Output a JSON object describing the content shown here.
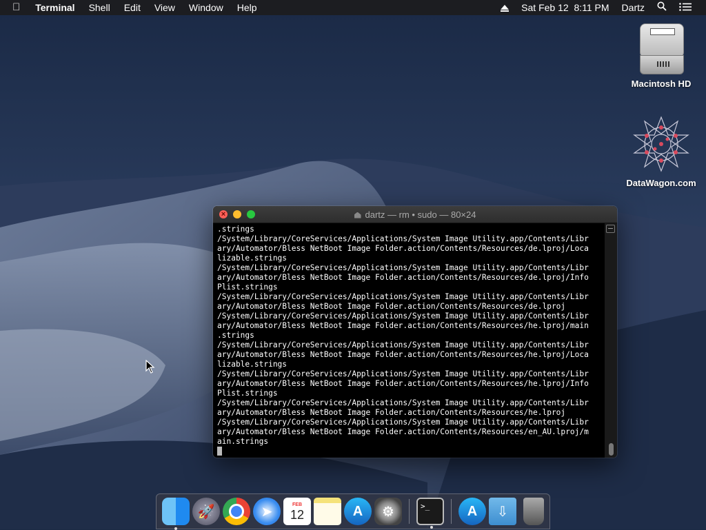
{
  "menubar": {
    "apple_icon": "apple-logo",
    "app_name": "Terminal",
    "menus": [
      "Shell",
      "Edit",
      "View",
      "Window",
      "Help"
    ],
    "clock": "Sat Feb 12  8:11 PM",
    "user": "Dartz"
  },
  "desktop": {
    "icons": [
      {
        "label": "Macintosh HD",
        "icon": "hard-drive"
      },
      {
        "label": "DataWagon.com",
        "icon": "geometric-star"
      }
    ]
  },
  "terminal": {
    "title": "dartz — rm • sudo — 80×24",
    "lines": [
      ".strings",
      "/System/Library/CoreServices/Applications/System Image Utility.app/Contents/Libr",
      "ary/Automator/Bless NetBoot Image Folder.action/Contents/Resources/de.lproj/Loca",
      "lizable.strings",
      "/System/Library/CoreServices/Applications/System Image Utility.app/Contents/Libr",
      "ary/Automator/Bless NetBoot Image Folder.action/Contents/Resources/de.lproj/Info",
      "Plist.strings",
      "/System/Library/CoreServices/Applications/System Image Utility.app/Contents/Libr",
      "ary/Automator/Bless NetBoot Image Folder.action/Contents/Resources/de.lproj",
      "/System/Library/CoreServices/Applications/System Image Utility.app/Contents/Libr",
      "ary/Automator/Bless NetBoot Image Folder.action/Contents/Resources/he.lproj/main",
      ".strings",
      "/System/Library/CoreServices/Applications/System Image Utility.app/Contents/Libr",
      "ary/Automator/Bless NetBoot Image Folder.action/Contents/Resources/he.lproj/Loca",
      "lizable.strings",
      "/System/Library/CoreServices/Applications/System Image Utility.app/Contents/Libr",
      "ary/Automator/Bless NetBoot Image Folder.action/Contents/Resources/he.lproj/Info",
      "Plist.strings",
      "/System/Library/CoreServices/Applications/System Image Utility.app/Contents/Libr",
      "ary/Automator/Bless NetBoot Image Folder.action/Contents/Resources/he.lproj",
      "/System/Library/CoreServices/Applications/System Image Utility.app/Contents/Libr",
      "ary/Automator/Bless NetBoot Image Folder.action/Contents/Resources/en_AU.lproj/m",
      "ain.strings"
    ]
  },
  "dock": {
    "calendar_month": "FEB",
    "calendar_day": "12",
    "terminal_prompt": ">_",
    "items": [
      "finder",
      "launchpad",
      "chrome",
      "safari",
      "calendar",
      "notes",
      "app-store",
      "system-preferences",
      "terminal",
      "app-store",
      "downloads",
      "trash"
    ]
  },
  "colors": {
    "close": "#ff5f57",
    "minimize": "#febc2e",
    "zoom": "#28c840"
  }
}
